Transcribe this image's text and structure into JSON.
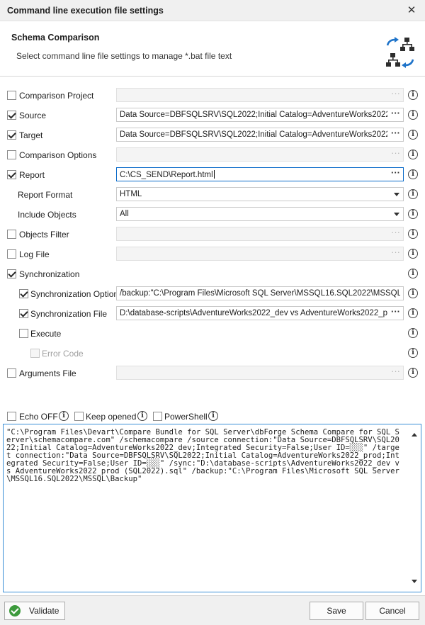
{
  "window": {
    "title": "Command line execution file settings"
  },
  "header": {
    "title": "Schema Comparison",
    "subtitle": "Select command line file settings to manage *.bat file text",
    "icon": "schema-compare-icon"
  },
  "options": {
    "comparison_project": {
      "label": "Comparison Project",
      "checked": false,
      "value": ""
    },
    "source": {
      "label": "Source",
      "checked": true,
      "value": "Data Source=DBFSQLSRV\\SQL2022;Initial Catalog=AdventureWorks2022_dev;"
    },
    "target": {
      "label": "Target",
      "checked": true,
      "value": "Data Source=DBFSQLSRV\\SQL2022;Initial Catalog=AdventureWorks2022_prod"
    },
    "comparison_options": {
      "label": "Comparison Options",
      "checked": false,
      "value": ""
    },
    "report": {
      "label": "Report",
      "checked": true,
      "value": "C:\\CS_SEND\\Report.html"
    },
    "report_format": {
      "label": "Report Format",
      "value": "HTML"
    },
    "include_objects": {
      "label": "Include Objects",
      "value": "All"
    },
    "objects_filter": {
      "label": "Objects Filter",
      "checked": false,
      "value": ""
    },
    "log_file": {
      "label": "Log File",
      "checked": false,
      "value": ""
    },
    "synchronization": {
      "label": "Synchronization",
      "checked": true
    },
    "sync_options": {
      "label": "Synchronization Options",
      "checked": true,
      "value": "/backup:\"C:\\Program Files\\Microsoft SQL Server\\MSSQL16.SQL2022\\MSSQL\\Backup\""
    },
    "sync_file": {
      "label": "Synchronization File",
      "checked": true,
      "value": "D:\\database-scripts\\AdventureWorks2022_dev vs AdventureWorks2022_prod (SQL2022).sql"
    },
    "execute": {
      "label": "Execute",
      "checked": false
    },
    "error_code": {
      "label": "Error Code",
      "checked": false
    },
    "arguments_file": {
      "label": "Arguments File",
      "checked": false,
      "value": ""
    }
  },
  "bottom_options": {
    "echo_off": {
      "label": "Echo OFF",
      "checked": false
    },
    "keep_opened": {
      "label": "Keep opened",
      "checked": false
    },
    "powershell": {
      "label": "PowerShell",
      "checked": false
    }
  },
  "command_text": "\"C:\\Program Files\\Devart\\Compare Bundle for SQL Server\\dbForge Schema Compare for SQL Server\\schemacompare.com\" /schemacompare /source connection:\"Data Source=DBFSQLSRV\\SQL2022;Initial Catalog=AdventureWorks2022_dev;Integrated Security=False;User ID=░░░\" /target connection:\"Data Source=DBFSQLSRV\\SQL2022;Initial Catalog=AdventureWorks2022_prod;Integrated Security=False;User ID=░░░\" /sync:\"D:\\database-scripts\\AdventureWorks2022_dev vs AdventureWorks2022_prod (SQL2022).sql\" /backup:\"C:\\Program Files\\Microsoft SQL Server\\MSSQL16.SQL2022\\MSSQL\\Backup\"",
  "buttons": {
    "validate": "Validate",
    "save": "Save",
    "cancel": "Cancel"
  },
  "colors": {
    "accent": "#0b6bc9",
    "validate_ok": "#3c9a3c"
  }
}
